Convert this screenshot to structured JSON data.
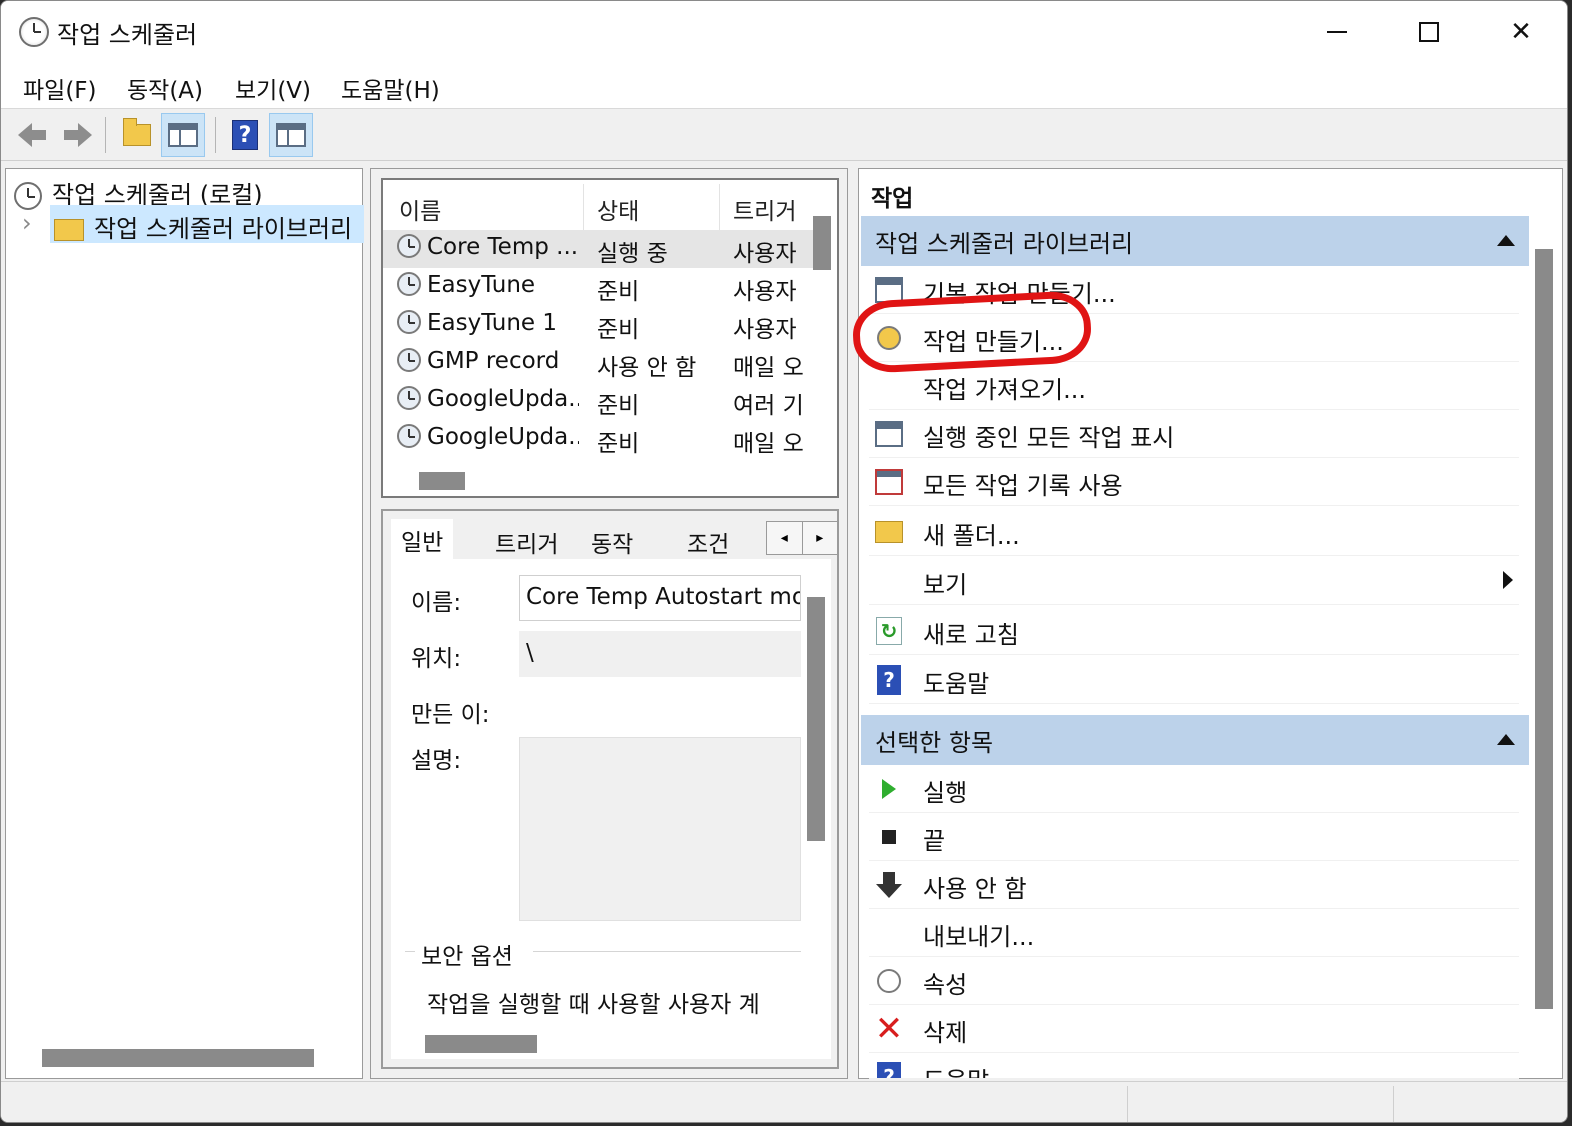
{
  "window": {
    "title": "작업 스케줄러",
    "minimize_glyph": "—",
    "close_glyph": "✕"
  },
  "menu": [
    "파일(F)",
    "동작(A)",
    "보기(V)",
    "도움말(H)"
  ],
  "toolbar": {
    "icons": [
      "back-arrow-icon",
      "forward-arrow-icon",
      "up-folder-icon",
      "show-hide-console-tree-icon",
      "help-icon",
      "show-hide-action-pane-icon"
    ],
    "help_glyph": "?"
  },
  "tree": {
    "root": "작업 스케줄러 (로컬)",
    "child": "작업 스케줄러 라이브러리",
    "expander": "›"
  },
  "task_list": {
    "columns": [
      "이름",
      "상태",
      "트리거"
    ],
    "rows": [
      {
        "name": "Core Temp ...",
        "status": "실행 중",
        "trigger": "사용자"
      },
      {
        "name": "EasyTune",
        "status": "준비",
        "trigger": "사용자"
      },
      {
        "name": "EasyTune 1",
        "status": "준비",
        "trigger": "사용자"
      },
      {
        "name": "GMP record",
        "status": "사용 안 함",
        "trigger": "매일 오"
      },
      {
        "name": "GoogleUpda...",
        "status": "준비",
        "trigger": "여러 기"
      },
      {
        "name": "GoogleUpda...",
        "status": "준비",
        "trigger": "매일 오"
      }
    ]
  },
  "details": {
    "tabs": [
      "일반",
      "트리거",
      "동작",
      "조건"
    ],
    "tab_prev": "◂",
    "tab_next": "▸",
    "name_label": "이름:",
    "name_value": "Core Temp Autostart mons",
    "location_label": "위치:",
    "location_value": "\\",
    "author_label": "만든 이:",
    "description_label": "설명:",
    "security_group": "보안 옵션",
    "security_text": "작업을 실행할 때 사용할 사용자 계"
  },
  "actions": {
    "title": "작업",
    "section1": {
      "header": "작업 스케줄러 라이브러리",
      "items": [
        {
          "label": "기본 작업 만들기...",
          "icon": "create-basic-task-icon"
        },
        {
          "label": "작업 만들기...",
          "icon": "create-task-icon"
        },
        {
          "label": "작업 가져오기...",
          "icon": ""
        },
        {
          "label": "실행 중인 모든 작업 표시",
          "icon": "running-tasks-icon"
        },
        {
          "label": "모든 작업 기록 사용",
          "icon": "task-history-icon"
        },
        {
          "label": "새 폴더...",
          "icon": "new-folder-icon"
        },
        {
          "label": "보기",
          "icon": ""
        },
        {
          "label": "새로 고침",
          "icon": "refresh-icon"
        },
        {
          "label": "도움말",
          "icon": "help-icon"
        }
      ]
    },
    "section2": {
      "header": "선택한 항목",
      "items": [
        {
          "label": "실행",
          "icon": "run-icon"
        },
        {
          "label": "끝",
          "icon": "end-icon"
        },
        {
          "label": "사용 안 함",
          "icon": "disable-icon"
        },
        {
          "label": "내보내기...",
          "icon": ""
        },
        {
          "label": "속성",
          "icon": "properties-icon"
        },
        {
          "label": "삭제",
          "icon": "delete-icon"
        },
        {
          "label": "도움말",
          "icon": "help-icon"
        }
      ]
    },
    "help_glyph": "?",
    "refresh_glyph": "↻",
    "delete_glyph": "✕"
  },
  "annotation": {
    "color": "#e01414",
    "target": "작업 만들기..."
  }
}
